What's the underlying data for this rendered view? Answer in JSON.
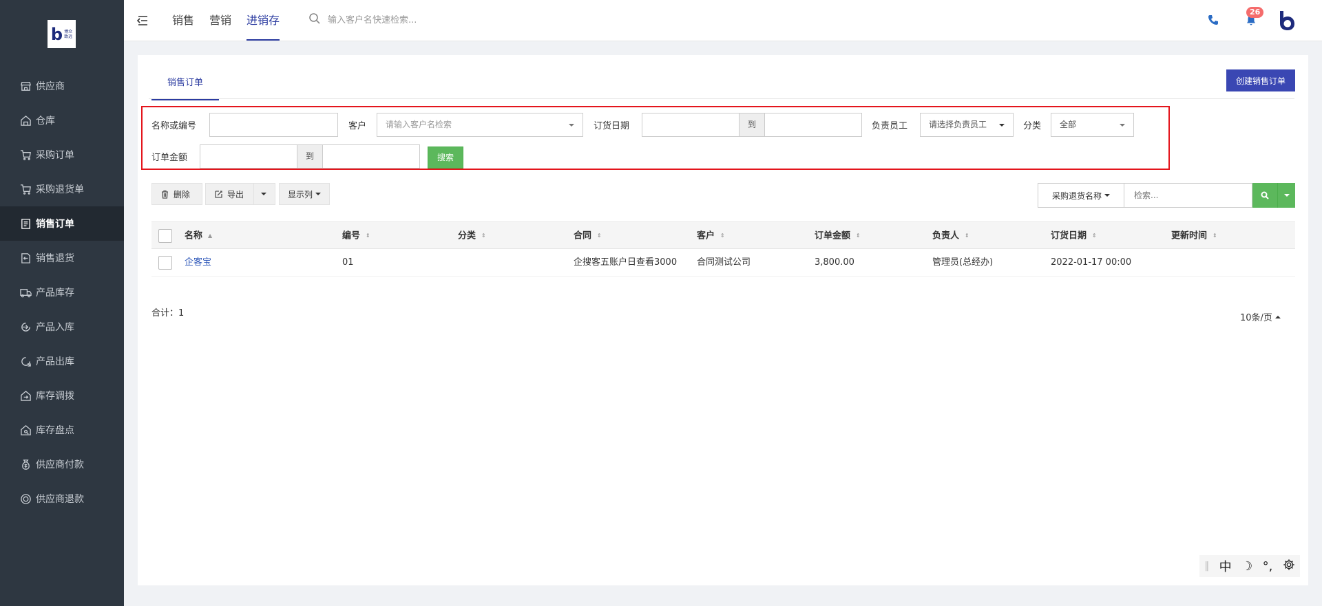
{
  "logo": {
    "mark": "b",
    "text_line1": "博众",
    "text_line2": "致远"
  },
  "sidebar": {
    "items": [
      {
        "label": "供应商",
        "icon": "store-icon"
      },
      {
        "label": "仓库",
        "icon": "warehouse-icon"
      },
      {
        "label": "采购订单",
        "icon": "cart-icon"
      },
      {
        "label": "采购退货单",
        "icon": "cart-return-icon"
      },
      {
        "label": "销售订单",
        "icon": "order-list-icon",
        "active": true
      },
      {
        "label": "销售退货",
        "icon": "return-doc-icon"
      },
      {
        "label": "产品库存",
        "icon": "truck-icon"
      },
      {
        "label": "产品入库",
        "icon": "inbound-icon"
      },
      {
        "label": "产品出库",
        "icon": "outbound-icon"
      },
      {
        "label": "库存调拨",
        "icon": "transfer-icon"
      },
      {
        "label": "库存盘点",
        "icon": "inventory-check-icon"
      },
      {
        "label": "供应商付款",
        "icon": "money-bag-icon"
      },
      {
        "label": "供应商退款",
        "icon": "refund-icon"
      }
    ]
  },
  "topbar": {
    "tabs": [
      "销售",
      "营销",
      "进销存"
    ],
    "active_tab": "进销存",
    "search_placeholder": "输入客户名快速检索...",
    "notification_count": "26"
  },
  "page": {
    "subtab": "销售订单",
    "create_button": "创建销售订单"
  },
  "filters": {
    "name_label": "名称或编号",
    "customer_label": "客户",
    "customer_placeholder": "请输入客户名检索",
    "date_label": "订货日期",
    "to_label": "到",
    "staff_label": "负责员工",
    "staff_select": "请选择负责员工",
    "category_label": "分类",
    "category_select": "全部",
    "amount_label": "订单金额",
    "search_button": "搜索"
  },
  "toolbar": {
    "delete": "删除",
    "export": "导出",
    "columns": "显示列",
    "search_field_select": "采购退货名称",
    "search_placeholder": "检索..."
  },
  "table": {
    "columns": [
      "名称",
      "编号",
      "分类",
      "合同",
      "客户",
      "订单金额",
      "负责人",
      "订货日期",
      "更新时间"
    ],
    "rows": [
      {
        "name": "企客宝",
        "code": "01",
        "category": "",
        "contract": "企搜客五账户日查看3000",
        "customer": "合同测试公司",
        "amount": "3,800.00",
        "owner": "管理员(总经办)",
        "order_date": "2022-01-17 00:00",
        "updated": ""
      }
    ]
  },
  "footer": {
    "total": "合计：1",
    "page_size": "10条/页"
  },
  "ime": {
    "lang": "中",
    "moon": "☽",
    "punct": "°,"
  }
}
